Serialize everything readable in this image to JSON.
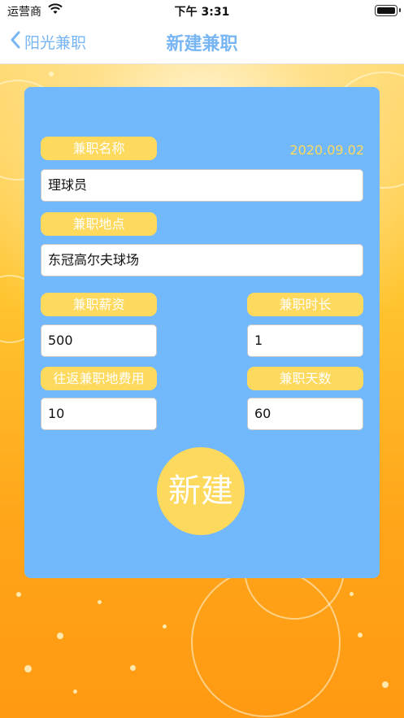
{
  "status_bar": {
    "carrier": "运营商",
    "time": "下午 3:31"
  },
  "nav": {
    "back_label": "阳光兼职",
    "title": "新建兼职"
  },
  "form": {
    "date": "2020.09.02",
    "name_label": "兼职名称",
    "name_value": "理球员",
    "location_label": "兼职地点",
    "location_value": "东冠高尔夫球场",
    "salary_label": "兼职薪资",
    "salary_value": "500",
    "duration_label": "兼职时长",
    "duration_value": "1",
    "travel_cost_label": "往返兼职地费用",
    "travel_cost_value": "10",
    "days_label": "兼职天数",
    "days_value": "60",
    "submit_label": "新建"
  },
  "colors": {
    "accent": "#78b5f3",
    "card": "#72b8fc",
    "pill": "#fdd95d"
  },
  "icons": [
    "wifi-icon",
    "battery-icon",
    "chevron-left-icon"
  ]
}
